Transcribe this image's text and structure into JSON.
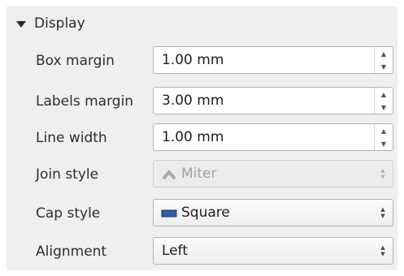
{
  "section": {
    "title": "Display",
    "expanded": true
  },
  "fields": {
    "box_margin": {
      "label": "Box margin",
      "value": "1.00 mm"
    },
    "labels_margin": {
      "label": "Labels margin",
      "value": "3.00 mm"
    },
    "line_width": {
      "label": "Line width",
      "value": "1.00 mm"
    },
    "join_style": {
      "label": "Join style",
      "value": "Miter",
      "icon": "miter-join-icon",
      "enabled": false
    },
    "cap_style": {
      "label": "Cap style",
      "value": "Square",
      "icon": "square-cap-icon",
      "enabled": true
    },
    "alignment": {
      "label": "Alignment",
      "value": "Left"
    }
  },
  "colors": {
    "panel_bg": "#efefef",
    "field_border": "#b4b4b4",
    "cap_icon_fill": "#2f5fa8"
  }
}
